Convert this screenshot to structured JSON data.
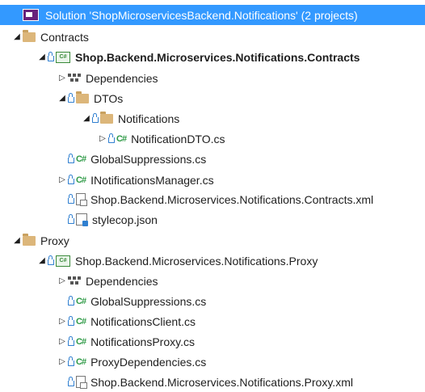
{
  "colors": {
    "selection": "#3399ff",
    "folder": "#dcb67a",
    "csharp": "#2e9a46",
    "lock": "#2f7fd0",
    "solution": "#68217a"
  },
  "tree": [
    {
      "label": "Solution 'ShopMicroservicesBackend.Notifications' (2 projects)",
      "icon": "solution-icon",
      "arrow": "none",
      "level": 0,
      "selected": true
    },
    {
      "label": "Contracts",
      "icon": "folder-icon",
      "arrow": "expanded",
      "level": 0
    },
    {
      "label": "Shop.Backend.Microservices.Notifications.Contracts",
      "icon": "csharp-project-icon",
      "arrow": "expanded",
      "level": 1,
      "lock": true,
      "bold": true
    },
    {
      "label": "Dependencies",
      "icon": "dependencies-icon",
      "arrow": "collapsed",
      "level": 2
    },
    {
      "label": "DTOs",
      "icon": "folder-icon",
      "arrow": "expanded",
      "level": 2,
      "lock": true
    },
    {
      "label": "Notifications",
      "icon": "folder-icon",
      "arrow": "expanded",
      "level": 3,
      "lock": true
    },
    {
      "label": "NotificationDTO.cs",
      "icon": "csharp-file-icon",
      "arrow": "collapsed",
      "level": 4,
      "lock": true
    },
    {
      "label": "GlobalSuppressions.cs",
      "icon": "csharp-file-icon",
      "arrow": "none",
      "level": 2,
      "lock": true
    },
    {
      "label": "INotificationsManager.cs",
      "icon": "csharp-file-icon",
      "arrow": "collapsed",
      "level": 2,
      "lock": true
    },
    {
      "label": "Shop.Backend.Microservices.Notifications.Contracts.xml",
      "icon": "xml-file-icon",
      "arrow": "none",
      "level": 2,
      "lock": true
    },
    {
      "label": "stylecop.json",
      "icon": "json-file-icon",
      "arrow": "none",
      "level": 2,
      "lock": true
    },
    {
      "label": "Proxy",
      "icon": "folder-icon",
      "arrow": "expanded",
      "level": 0
    },
    {
      "label": "Shop.Backend.Microservices.Notifications.Proxy",
      "icon": "csharp-project-icon",
      "arrow": "expanded",
      "level": 1,
      "lock": true
    },
    {
      "label": "Dependencies",
      "icon": "dependencies-icon",
      "arrow": "collapsed",
      "level": 2
    },
    {
      "label": "GlobalSuppressions.cs",
      "icon": "csharp-file-icon",
      "arrow": "none",
      "level": 2,
      "lock": true
    },
    {
      "label": "NotificationsClient.cs",
      "icon": "csharp-file-icon",
      "arrow": "collapsed",
      "level": 2,
      "lock": true
    },
    {
      "label": "NotificationsProxy.cs",
      "icon": "csharp-file-icon",
      "arrow": "collapsed",
      "level": 2,
      "lock": true
    },
    {
      "label": "ProxyDependencies.cs",
      "icon": "csharp-file-icon",
      "arrow": "collapsed",
      "level": 2,
      "lock": true
    },
    {
      "label": "Shop.Backend.Microservices.Notifications.Proxy.xml",
      "icon": "xml-file-icon",
      "arrow": "none",
      "level": 2,
      "lock": true
    }
  ]
}
